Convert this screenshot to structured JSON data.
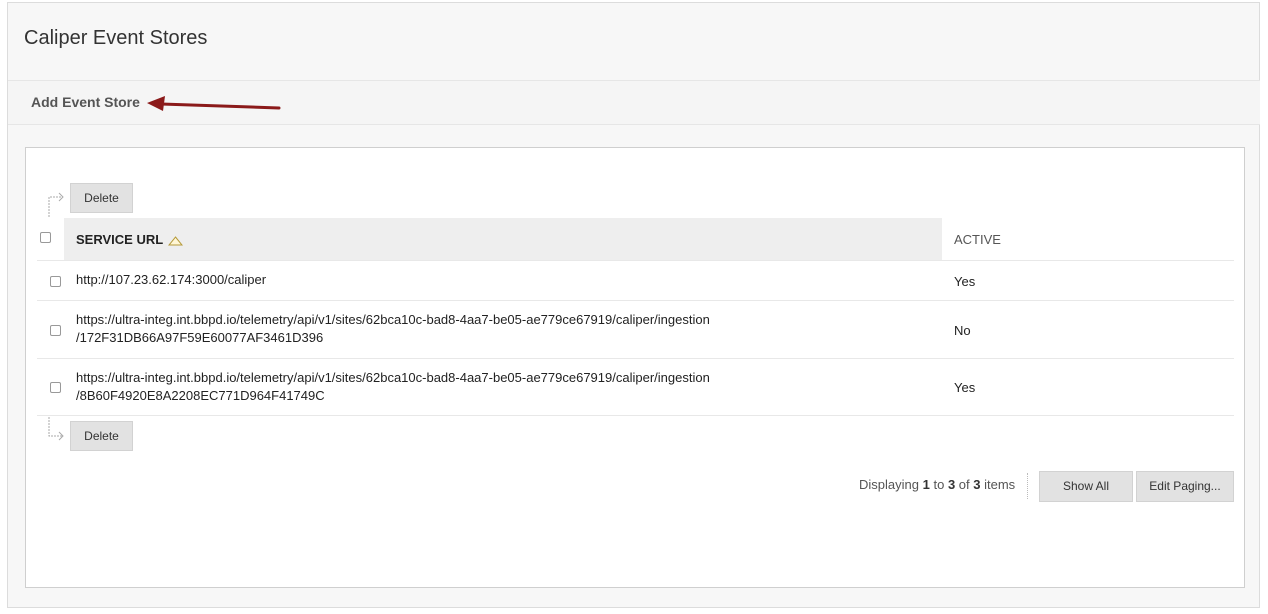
{
  "page": {
    "title": "Caliper Event Stores"
  },
  "action_bar": {
    "add_label": "Add Event Store"
  },
  "table": {
    "delete_label": "Delete",
    "columns": {
      "service_url": "SERVICE URL",
      "active": "ACTIVE"
    },
    "rows": [
      {
        "url_line1": "http://107.23.62.174:3000/caliper",
        "url_line2": "",
        "active": "Yes"
      },
      {
        "url_line1": "https://ultra-integ.int.bbpd.io/telemetry/api/v1/sites/62bca10c-bad8-4aa7-be05-ae779ce67919/caliper/ingestion",
        "url_line2": "/172F31DB66A97F59E60077AF3461D396",
        "active": "No"
      },
      {
        "url_line1": "https://ultra-integ.int.bbpd.io/telemetry/api/v1/sites/62bca10c-bad8-4aa7-be05-ae779ce67919/caliper/ingestion",
        "url_line2": "/8B60F4920E8A2208EC771D964F41749C",
        "active": "Yes"
      }
    ]
  },
  "paging": {
    "prefix": "Displaying",
    "start": "1",
    "to": "to",
    "end": "3",
    "of": "of",
    "total": "3",
    "suffix": "items",
    "show_all_label": "Show All",
    "edit_paging_label": "Edit Paging..."
  },
  "colors": {
    "annotation_arrow": "#8b1a1a",
    "header_bg": "#eeeeee",
    "button_bg": "#e2e2e2"
  },
  "icons": {
    "sort": "sort-ascending-icon",
    "arrow": "annotation-arrow-icon"
  }
}
